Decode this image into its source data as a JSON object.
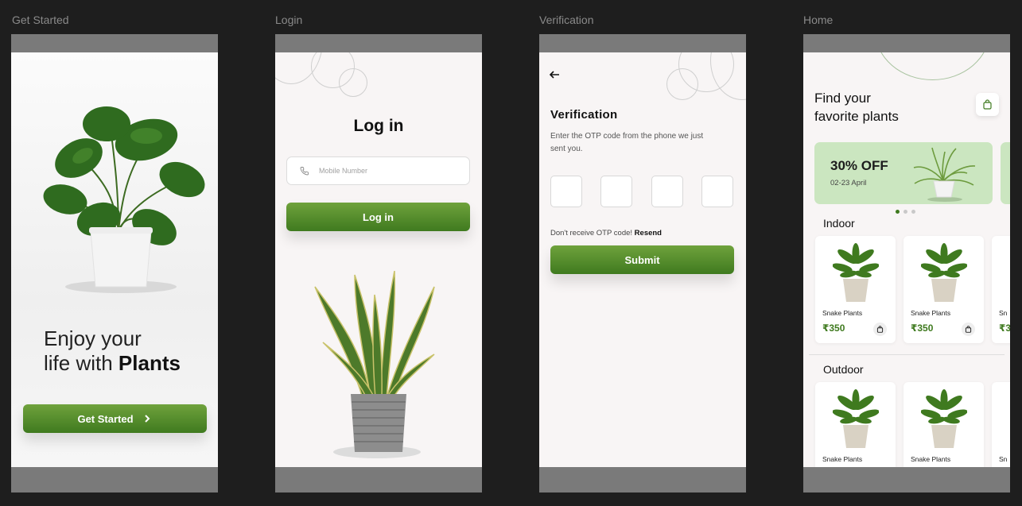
{
  "frames": {
    "get_started": {
      "label": "Get Started",
      "headline_line1": "Enjoy your",
      "headline_line2_prefix": "life with ",
      "headline_bold": "Plants",
      "cta_label": "Get Started",
      "cta_icon": "chevron-right-icon"
    },
    "login": {
      "label": "Login",
      "title": "Log in",
      "phone_placeholder": "Mobile Number",
      "phone_icon": "phone-icon",
      "login_button": "Log in"
    },
    "verification": {
      "label": "Verification",
      "back_icon": "arrow-left-icon",
      "title": "Verification",
      "description": "Enter the OTP code from the phone we just sent you.",
      "otp_digits": [
        "",
        "",
        "",
        ""
      ],
      "resend_prompt": "Don't receive OTP code! ",
      "resend_link": "Resend",
      "submit_button": "Submit"
    },
    "home": {
      "label": "Home",
      "title_line1": "Find your",
      "title_line2": "favorite plants",
      "cart_icon": "shopping-bag-icon",
      "promo": {
        "title": "30% OFF",
        "date": "02-23 April"
      },
      "carousel_active_index": 0,
      "indoor_title": "Indoor",
      "indoor_products": [
        {
          "name": "Snake Plants",
          "price": "₹350"
        },
        {
          "name": "Snake Plants",
          "price": "₹350"
        },
        {
          "name": "Snake Plants",
          "price": "₹3"
        }
      ],
      "outdoor_title": "Outdoor",
      "outdoor_products": [
        {
          "name": "Snake Plants"
        },
        {
          "name": "Snake Plants"
        },
        {
          "name": "Sn"
        }
      ]
    }
  },
  "colors": {
    "brand_green": "#3f7a1f",
    "brand_green_light": "#6fa23c",
    "promo_bg": "#cbe6c0",
    "canvas_bg": "#1e1e1e"
  }
}
